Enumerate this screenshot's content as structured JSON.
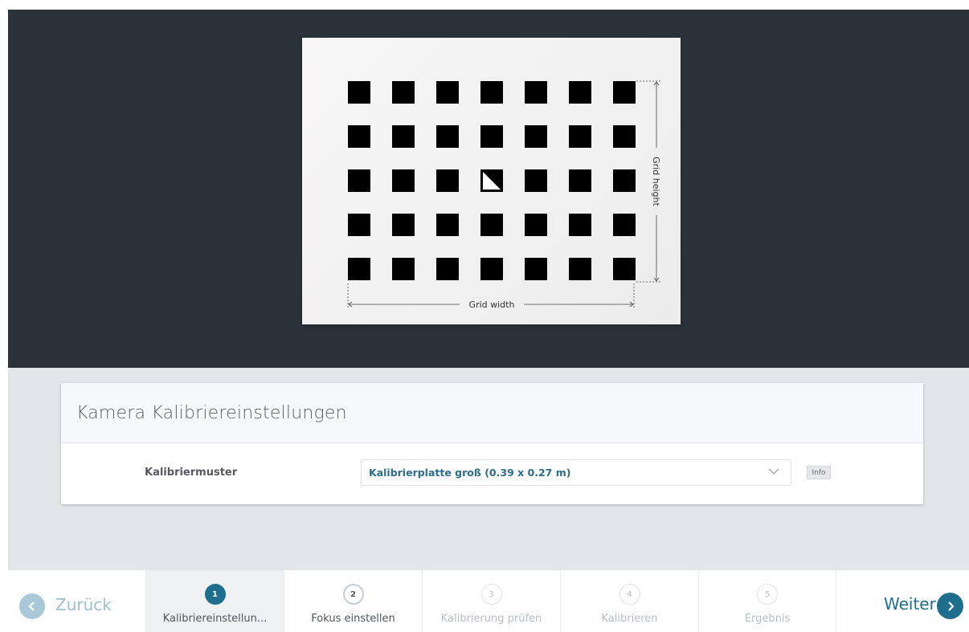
{
  "preview": {
    "grid_height_label": "Grid height",
    "grid_width_label": "Grid width",
    "grid_columns": 7,
    "grid_rows": 5
  },
  "settings": {
    "title": "Kamera Kalibriereinstellungen",
    "field_label": "Kalibriermuster",
    "selected_value": "Kalibrierplatte groß (0.39 x 0.27 m)",
    "info_label": "Info"
  },
  "footer": {
    "back_label": "Zurück",
    "next_label": "Weiter",
    "steps": [
      {
        "number": "1",
        "label": "Kalibriereinstellun...",
        "state": "active"
      },
      {
        "number": "2",
        "label": "Fokus einstellen",
        "state": "next"
      },
      {
        "number": "3",
        "label": "Kalibrierung prüfen",
        "state": "disabled"
      },
      {
        "number": "4",
        "label": "Kalibrieren",
        "state": "disabled"
      },
      {
        "number": "5",
        "label": "Ergebnis",
        "state": "disabled"
      }
    ]
  },
  "colors": {
    "accent": "#1e6f8e",
    "preview_bg": "#2c323a",
    "page_bg": "#e3e6e9"
  },
  "icons": [
    "chevron-left-icon",
    "chevron-right-icon",
    "chevron-down-icon",
    "dimension-arrow-icon"
  ]
}
